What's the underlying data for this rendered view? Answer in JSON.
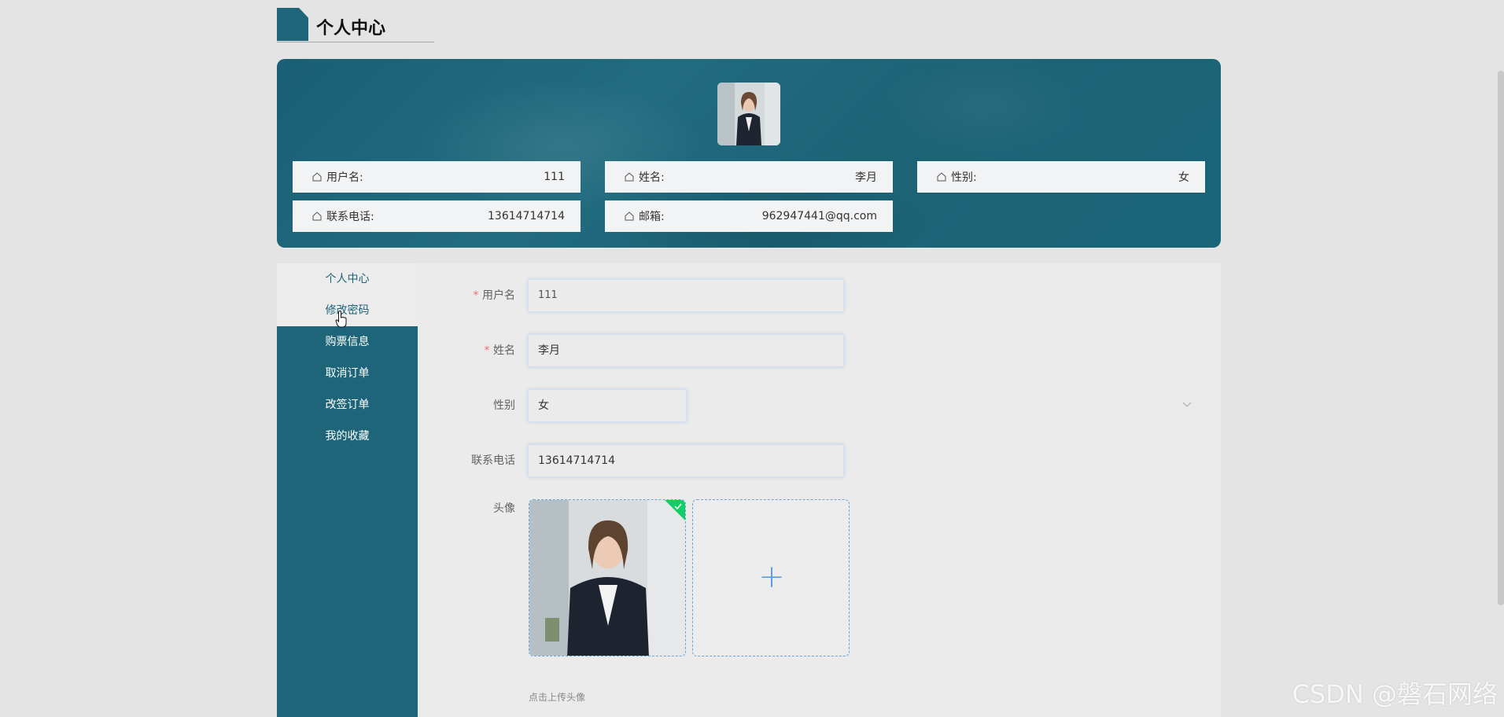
{
  "page": {
    "title": "个人中心"
  },
  "profile": {
    "fields": [
      {
        "label": "用户名:",
        "value": "111"
      },
      {
        "label": "姓名:",
        "value": "李月"
      },
      {
        "label": "性别:",
        "value": "女"
      },
      {
        "label": "联系电话:",
        "value": "13614714714"
      },
      {
        "label": "邮箱:",
        "value": "962947441@qq.com"
      }
    ]
  },
  "sidebar": {
    "items": [
      {
        "label": "个人中心"
      },
      {
        "label": "修改密码"
      },
      {
        "label": "购票信息"
      },
      {
        "label": "取消订单"
      },
      {
        "label": "改签订单"
      },
      {
        "label": "我的收藏"
      }
    ]
  },
  "form": {
    "username": {
      "label": "用户名",
      "required": "*",
      "value": "111"
    },
    "name": {
      "label": "姓名",
      "required": "*",
      "value": "李月"
    },
    "gender": {
      "label": "性别",
      "value": "女"
    },
    "phone": {
      "label": "联系电话",
      "value": "13614714714"
    },
    "avatar": {
      "label": "头像",
      "upload_tip": "点击上传头像",
      "plus": "+"
    }
  },
  "watermark": "CSDN @磐石网络",
  "colors": {
    "primary": "#1e6579",
    "required": "#f56c6c",
    "success": "#13ce66",
    "upload_border": "#6aa4d8"
  }
}
